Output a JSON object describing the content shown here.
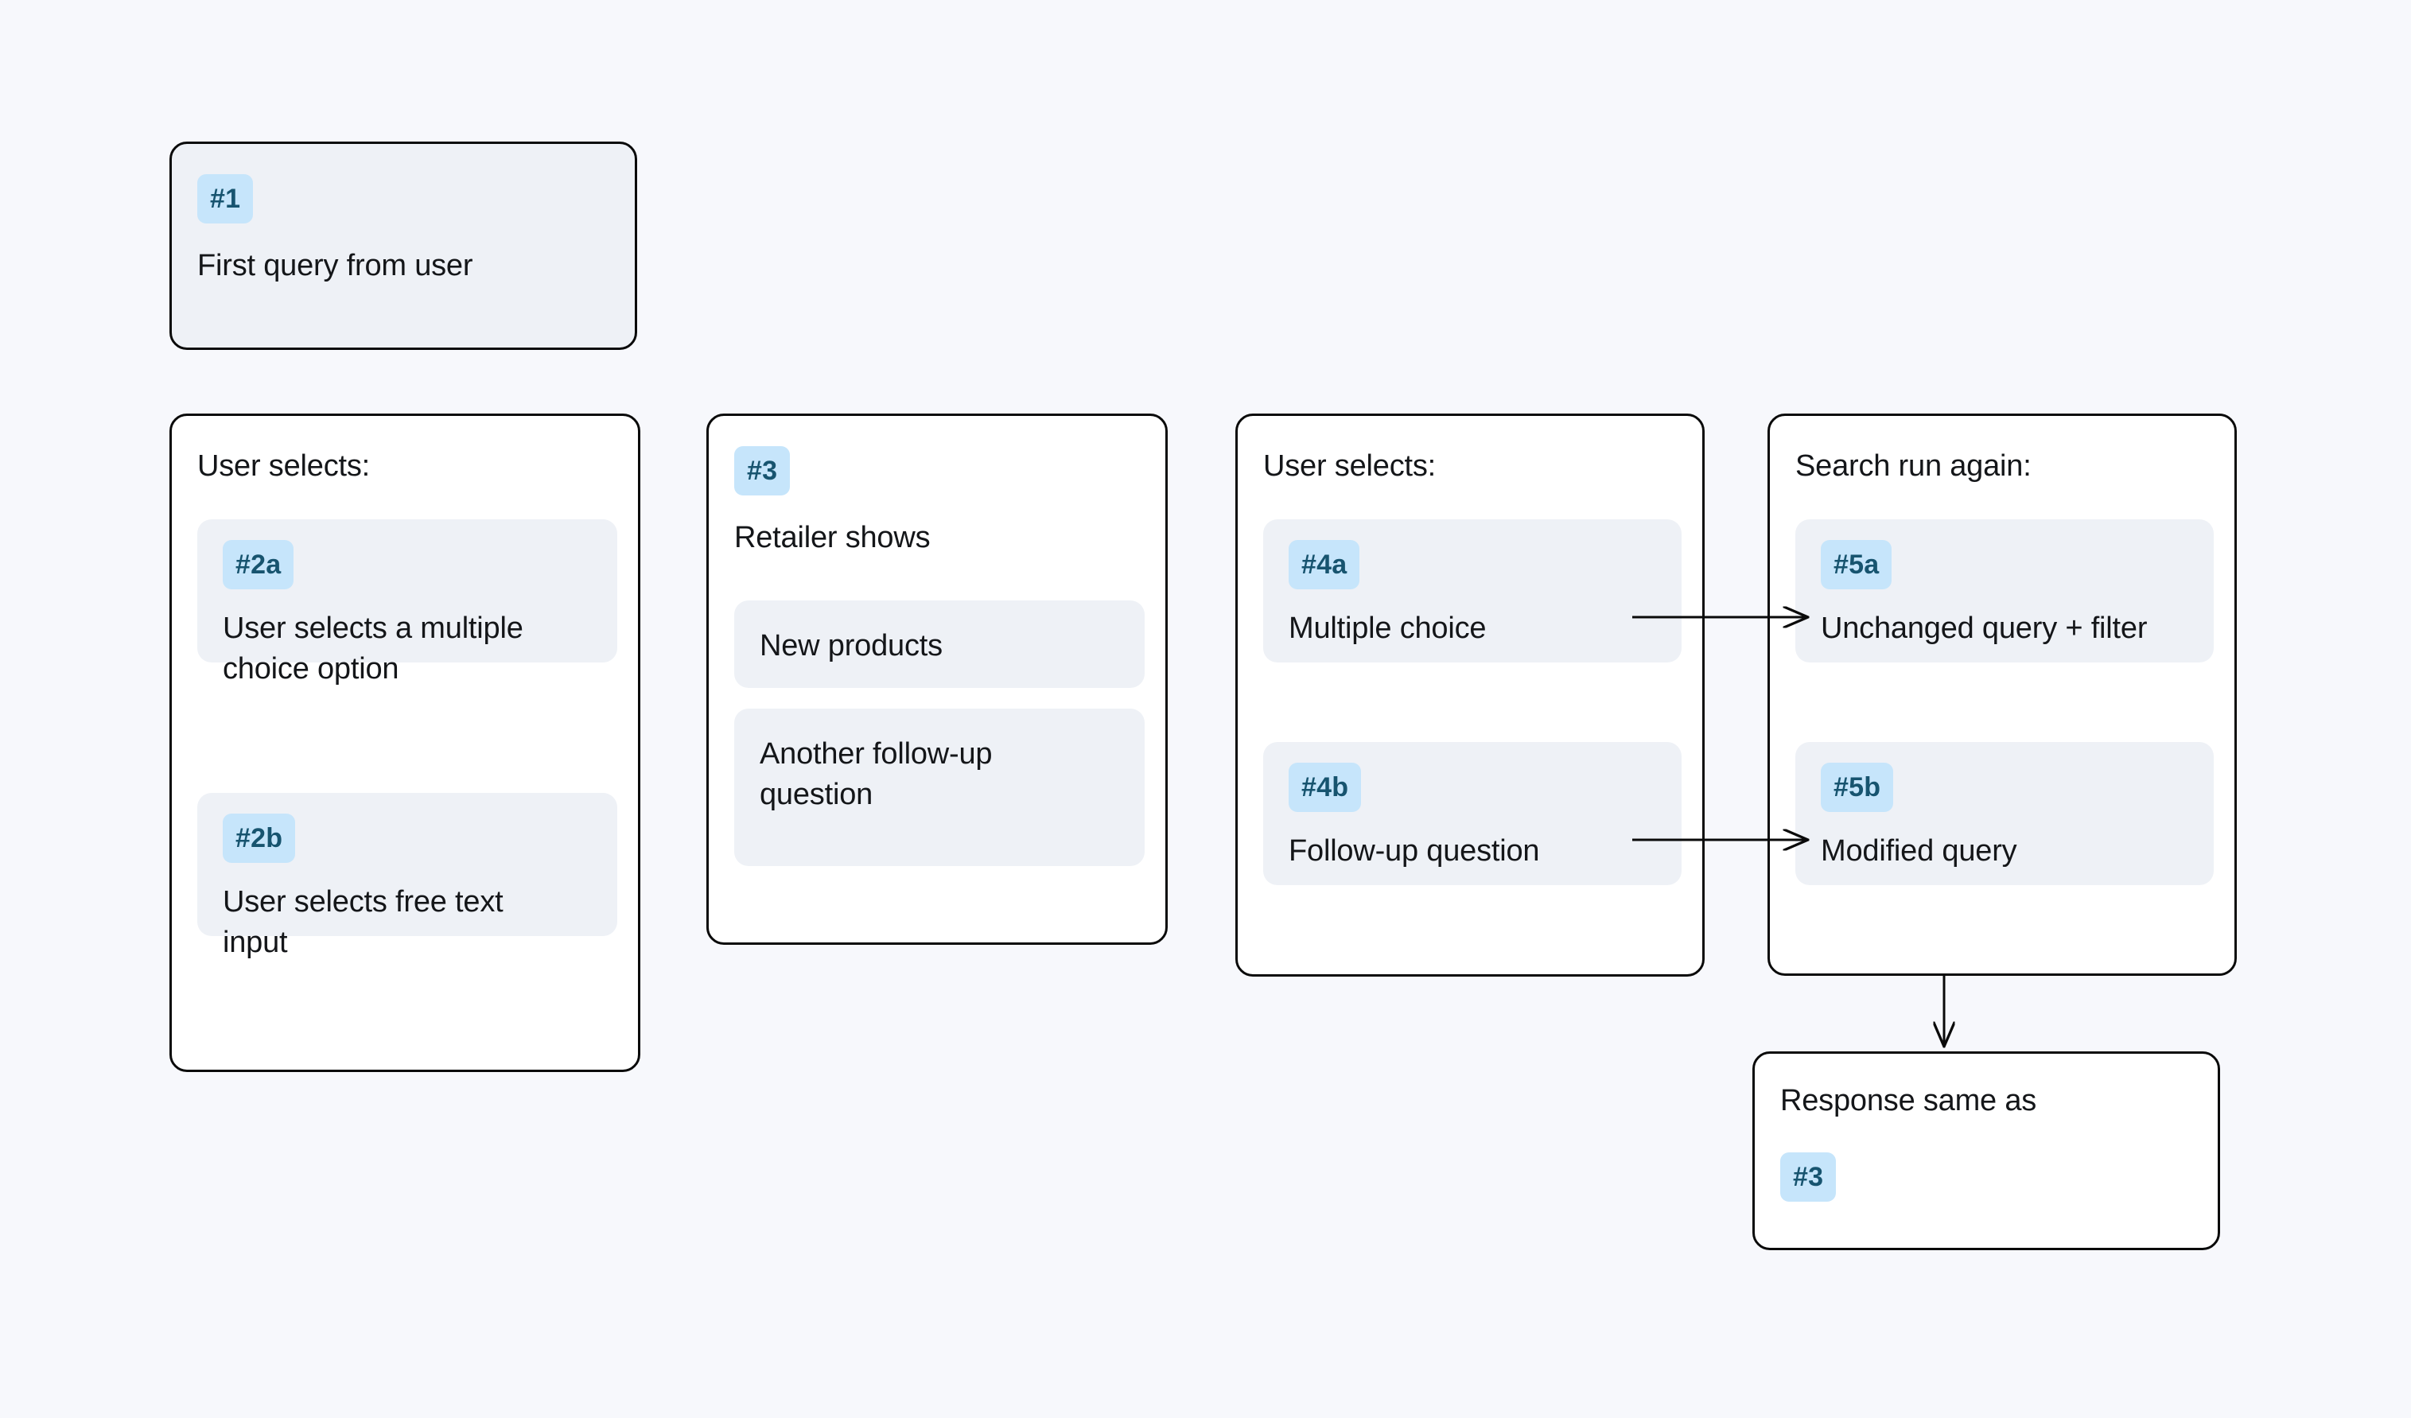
{
  "diagram": {
    "background_color": "#f7f8fc",
    "card_fill_color": "#eef1f6",
    "card_border_color": "#0a0a0a",
    "badge_bg_color": "#c6e5fb",
    "badge_text_color": "#17546f",
    "text_color": "#141619"
  },
  "step1": {
    "badge": "#1",
    "text": "First query from user"
  },
  "step2": {
    "heading": "User selects:",
    "options": [
      {
        "badge": "#2a",
        "text": "User selects a multiple choice option"
      },
      {
        "badge": "#2b",
        "text": "User selects free text input"
      }
    ]
  },
  "step3": {
    "badge": "#3",
    "heading": "Retailer shows",
    "options": [
      {
        "text": "New products"
      },
      {
        "text": "Another follow-up question"
      }
    ]
  },
  "step4": {
    "heading": "User selects:",
    "options": [
      {
        "badge": "#4a",
        "text": "Multiple choice"
      },
      {
        "badge": "#4b",
        "text": "Follow-up question"
      }
    ]
  },
  "step5": {
    "heading": "Search run again:",
    "options": [
      {
        "badge": "#5a",
        "text": "Unchanged query + filter"
      },
      {
        "badge": "#5b",
        "text": "Modified query"
      }
    ]
  },
  "step6": {
    "heading": "Response same as",
    "badge": "#3"
  },
  "connectors": [
    {
      "name": "arrow-4a-to-5a",
      "type": "horizontal-arrow"
    },
    {
      "name": "arrow-4b-to-5b",
      "type": "horizontal-arrow"
    },
    {
      "name": "arrow-5-to-response",
      "type": "vertical-arrow"
    }
  ]
}
